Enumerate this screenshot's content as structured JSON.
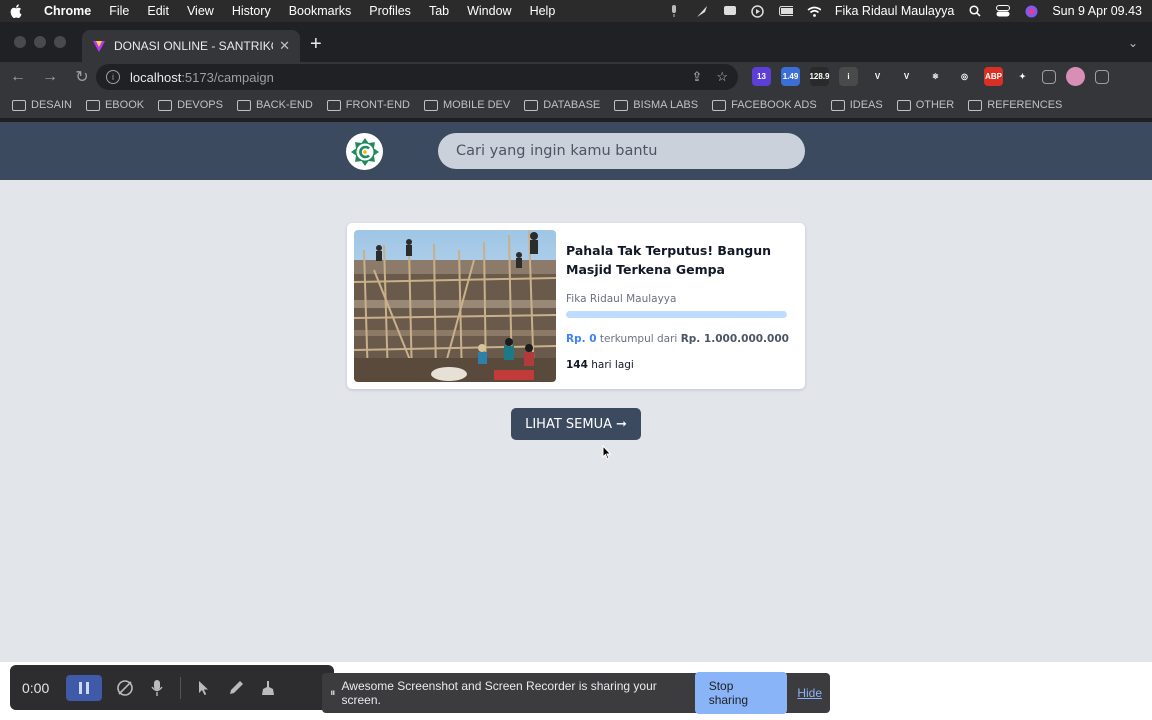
{
  "menubar": {
    "app": "Chrome",
    "items": [
      "File",
      "Edit",
      "View",
      "History",
      "Bookmarks",
      "Profiles",
      "Tab",
      "Window",
      "Help"
    ],
    "user": "Fika Ridaul Maulayya",
    "datetime": "Sun 9 Apr  09.43"
  },
  "browser": {
    "tab_title": "DONASI ONLINE - SANTRIKODING",
    "url_host": "localhost",
    "url_path": ":5173/campaign",
    "extensions": [
      {
        "name": "badge-13",
        "text": "13",
        "color": "#5b3fd6"
      },
      {
        "name": "badge-149",
        "text": "1.49",
        "color": "#3b6fd6"
      },
      {
        "name": "fid-128",
        "text": "128.9",
        "color": "#2a2a2a"
      },
      {
        "name": "italic-i",
        "text": "i",
        "color": "#4a4a4a"
      },
      {
        "name": "vue-1",
        "text": "V",
        "color": "#35363a"
      },
      {
        "name": "vue-2",
        "text": "V",
        "color": "#35363a"
      },
      {
        "name": "react",
        "text": "⚛",
        "color": "#35363a"
      },
      {
        "name": "ring",
        "text": "◎",
        "color": "#35363a"
      },
      {
        "name": "abp",
        "text": "ABP",
        "color": "#d93025"
      },
      {
        "name": "puzzle",
        "text": "✦",
        "color": "#35363a"
      }
    ]
  },
  "bookmarks": [
    "DESAIN",
    "EBOOK",
    "DEVOPS",
    "BACK-END",
    "FRONT-END",
    "MOBILE DEV",
    "DATABASE",
    "BISMA LABS",
    "FACEBOOK ADS",
    "IDEAS",
    "OTHER",
    "REFERENCES"
  ],
  "site": {
    "search_placeholder": "Cari yang ingin kamu bantu",
    "see_all_label": "LIHAT SEMUA",
    "see_all_arrow": "➞"
  },
  "campaign": {
    "title": "Pahala Tak Terputus! Bangun Masjid Terkena Gempa",
    "author": "Fika Ridaul Maulayya",
    "collected": "Rp. 0",
    "collected_label": " terkumpul dari ",
    "target": "Rp. 1.000.000.000",
    "progress": 0,
    "days": "144",
    "days_label": " hari lagi"
  },
  "recorder": {
    "time": "0:00"
  },
  "share_banner": {
    "pause": "⏸",
    "message": "Awesome Screenshot and Screen Recorder is sharing your screen.",
    "stop_label": "Stop sharing",
    "hide_label": "Hide"
  },
  "colors": {
    "header": "#3b4a5e",
    "page_bg": "#e2e5ea",
    "accent": "#3b82f6",
    "progress_track": "#bfdbfe"
  }
}
